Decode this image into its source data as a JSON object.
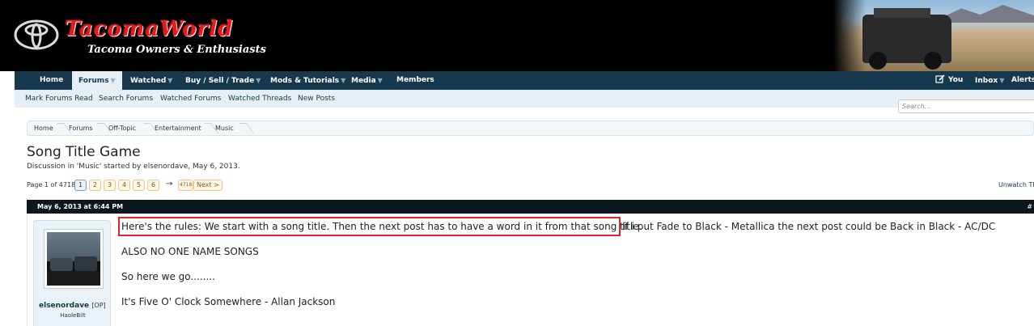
{
  "header": {
    "logo_title": "TacomaWorld",
    "logo_subtitle": "Tacoma Owners & Enthusiasts"
  },
  "nav": {
    "items": [
      {
        "label": "Home",
        "caret": ""
      },
      {
        "label": "Forums",
        "caret": "▼"
      },
      {
        "label": "Watched",
        "caret": "▼"
      },
      {
        "label": "Buy / Sell / Trade",
        "caret": "▼"
      },
      {
        "label": "Mods & Tutorials",
        "caret": "▼"
      },
      {
        "label": "Media",
        "caret": "▼"
      },
      {
        "label": "Members",
        "caret": ""
      }
    ],
    "right": {
      "you": "You",
      "inbox": "Inbox",
      "alerts": "Alerts",
      "caret": "▼"
    }
  },
  "subnav": {
    "items": [
      "Mark Forums Read",
      "Search Forums",
      "Watched Forums",
      "Watched Threads",
      "New Posts"
    ],
    "search_placeholder": "Search..."
  },
  "breadcrumb": [
    "Home",
    "Forums",
    "Off-Topic",
    "Entertainment",
    "Music"
  ],
  "thread": {
    "title": "Song Title Game",
    "description": "Discussion in 'Music' started by elsenordave, May 6, 2013."
  },
  "pagination": {
    "label": "Page 1 of 4718",
    "pages": [
      "1",
      "2",
      "3",
      "4",
      "5",
      "6"
    ],
    "arrow": "→",
    "last": "4718",
    "next": "Next >",
    "unwatch": "Unwatch Th"
  },
  "post": {
    "date": "May 6, 2013 at 6:44 PM",
    "number": "#",
    "username": "elsenordave",
    "op_tag": "[OP]",
    "user_title": "HaoleBilt",
    "lines": [
      "Here's the rules: We start with a song title. Then the next post has to have a word in it from that song title.",
      "If i put Fade to Black - Metallica the next post could be Back in Black - AC/DC",
      "ALSO NO ONE NAME SONGS",
      "So here we go........",
      "It's Five O' Clock Somewhere - Allan Jackson"
    ]
  },
  "colors": {
    "nav_bg": "#17394f",
    "subnav_bg": "#e7eef4",
    "post_header_bg": "#0d1722",
    "highlight": "#e3252b",
    "logo_red": "#e41c1c"
  }
}
